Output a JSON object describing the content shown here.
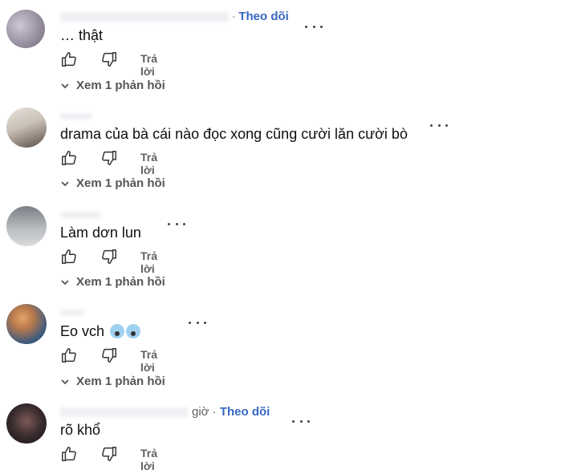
{
  "comments": [
    {
      "time": "",
      "follow_label": "Theo dõi",
      "text": "… thật",
      "reply_label": "Trả lời",
      "view_replies_label": "Xem 1 phản hồi"
    },
    {
      "time": "",
      "follow_label": "",
      "text": "drama của bà cái nào đọc xong cũng cười lăn cười bò",
      "reply_label": "Trả lời",
      "view_replies_label": "Xem 1 phản hồi"
    },
    {
      "time": "",
      "follow_label": "",
      "text": "Làm dơn lun",
      "reply_label": "Trả lời",
      "view_replies_label": "Xem 1 phản hồi"
    },
    {
      "time": "",
      "follow_label": "",
      "text": "Eo vch",
      "emojis": [
        "screaming-face-emoji",
        "screaming-face-emoji"
      ],
      "reply_label": "Trả lời",
      "view_replies_label": "Xem 1 phản hồi"
    },
    {
      "time": "giờ ·",
      "follow_label": "Theo dõi",
      "text": "rõ khổ",
      "reply_label": "Trả lời"
    }
  ],
  "icons": {
    "like": "thumb-up-icon",
    "dislike": "thumb-down-icon",
    "more": "more-dots-icon",
    "expand": "chevron-down-icon"
  },
  "colors": {
    "follow": "#3767c4",
    "secondary_text": "#606060"
  }
}
